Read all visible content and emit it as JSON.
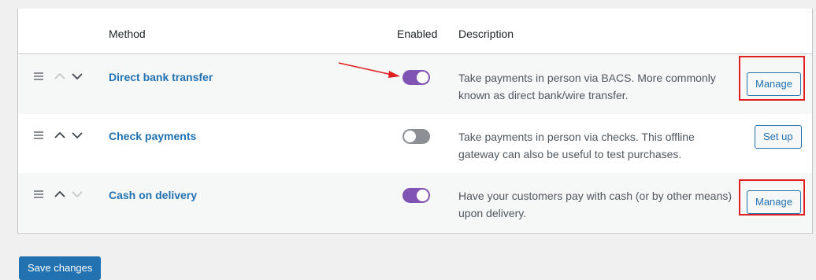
{
  "table": {
    "headers": {
      "method": "Method",
      "enabled": "Enabled",
      "description": "Description"
    },
    "rows": [
      {
        "name": "Direct bank transfer",
        "enabled": true,
        "description": "Take payments in person via BACS. More commonly known as direct bank/wire transfer.",
        "action_label": "Manage"
      },
      {
        "name": "Check payments",
        "enabled": false,
        "description": "Take payments in person via checks. This offline gateway can also be useful to test purchases.",
        "action_label": "Set up"
      },
      {
        "name": "Cash on delivery",
        "enabled": true,
        "description": "Have your customers pay with cash (or by other means) upon delivery.",
        "action_label": "Manage"
      }
    ]
  },
  "footer": {
    "save_label": "Save changes"
  },
  "colors": {
    "toggle_on": "#7f54b3",
    "toggle_off": "#8c8f94",
    "link": "#2271b1",
    "annotation": "#e02020"
  }
}
